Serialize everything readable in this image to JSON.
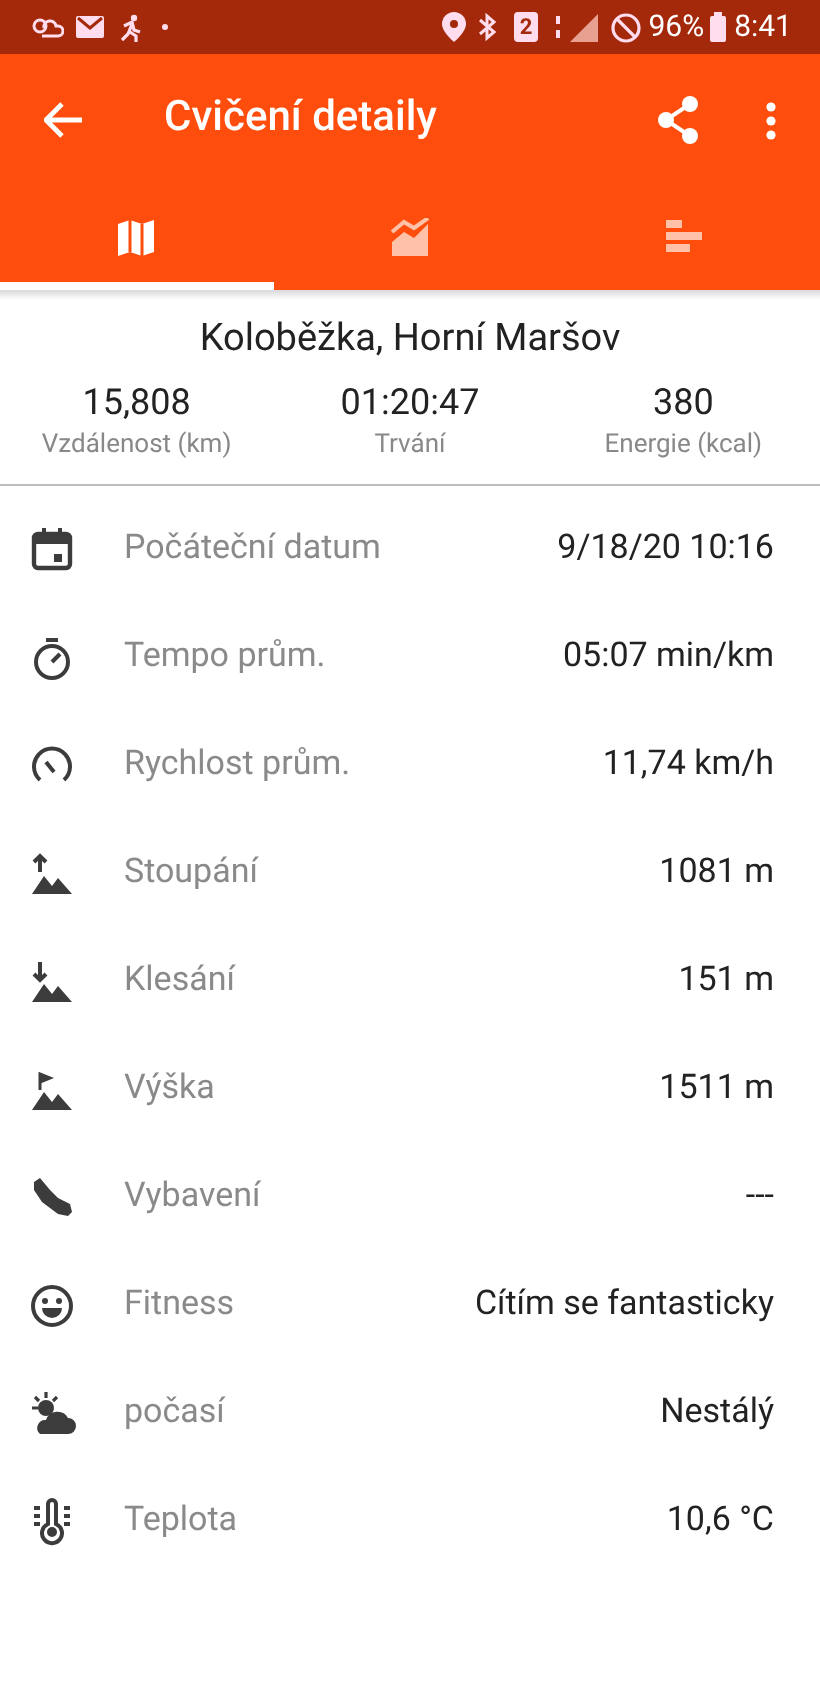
{
  "status_bar": {
    "sim_badge": "2",
    "battery": "96%",
    "time": "8:41"
  },
  "app_bar": {
    "title": "Cvičení detaily"
  },
  "tabs": [
    {
      "selected": true
    },
    {
      "selected": false
    },
    {
      "selected": false
    }
  ],
  "summary": {
    "title": "Koloběžka, Horní Maršov",
    "stats": [
      {
        "value": "15,808",
        "label": "Vzdálenost (km)"
      },
      {
        "value": "01:20:47",
        "label": "Trvání"
      },
      {
        "value": "380",
        "label": "Energie (kcal)"
      }
    ]
  },
  "details": [
    {
      "label": "Počáteční datum",
      "value": "9/18/20 10:16"
    },
    {
      "label": "Tempo prům.",
      "value": "05:07 min/km"
    },
    {
      "label": "Rychlost prům.",
      "value": "11,74 km/h"
    },
    {
      "label": "Stoupání",
      "value": "1081 m"
    },
    {
      "label": "Klesání",
      "value": "151 m"
    },
    {
      "label": "Výška",
      "value": "1511 m"
    },
    {
      "label": "Vybavení",
      "value": "---"
    },
    {
      "label": "Fitness",
      "value": "Cítím se fantasticky"
    },
    {
      "label": "počasí",
      "value": "Nestálý"
    },
    {
      "label": "Teplota",
      "value": "10,6 °C"
    }
  ]
}
